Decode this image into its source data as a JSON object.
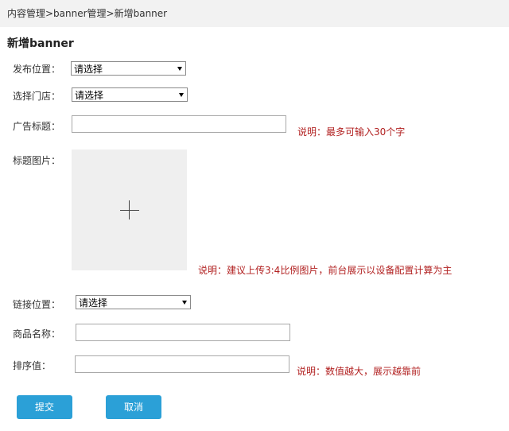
{
  "breadcrumb": {
    "text": "内容管理>banner管理>新增banner"
  },
  "page": {
    "title": "新增banner"
  },
  "form": {
    "publish_position": {
      "label": "发布位置：",
      "value": "请选择"
    },
    "select_store": {
      "label": "选择门店：",
      "value": "请选择"
    },
    "ad_title": {
      "label": "广告标题：",
      "value": "",
      "note": "说明：最多可输入30个字"
    },
    "title_image": {
      "label": "标题图片：",
      "note": "说明：建议上传3:4比例图片，前台展示以设备配置计算为主"
    },
    "link_position": {
      "label": "链接位置：",
      "value": "请选择"
    },
    "product_name": {
      "label": "商品名称：",
      "value": ""
    },
    "sort_value": {
      "label": "排序值：",
      "value": "",
      "note": "说明：数值越大，展示越靠前"
    }
  },
  "buttons": {
    "submit": "提交",
    "cancel": "取消"
  },
  "colors": {
    "accent": "#2ba0d7",
    "note": "#b22222",
    "breadcrumb_bg": "#f2f2f2"
  },
  "icons": {
    "upload": "plus-icon",
    "dropdown": "chevron-down-icon"
  }
}
